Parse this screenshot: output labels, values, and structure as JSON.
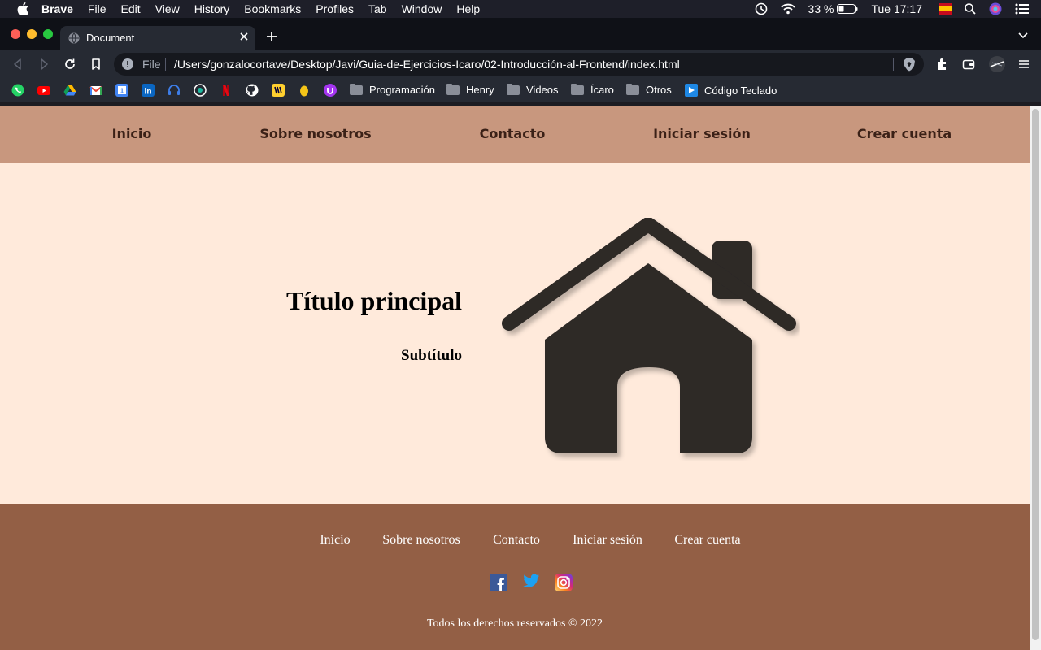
{
  "menubar": {
    "app": "Brave",
    "items": [
      "File",
      "Edit",
      "View",
      "History",
      "Bookmarks",
      "Profiles",
      "Tab",
      "Window",
      "Help"
    ],
    "battery": "33 %",
    "clock": "Tue 17:17"
  },
  "browser": {
    "tab_title": "Document",
    "url_scheme": "File",
    "url": "/Users/gonzalocortave/Desktop/Javi/Guia-de-Ejercicios-Icaro/02-Introducción-al-Frontend/index.html"
  },
  "bookmarks": {
    "icons": [
      "whatsapp-icon",
      "youtube-icon",
      "google-drive-icon",
      "gmail-icon",
      "google-calendar-icon",
      "linkedin-icon",
      "headphones-icon",
      "music-icon",
      "netflix-icon",
      "github-icon",
      "miro-icon",
      "egg-icon",
      "udemy-icon"
    ],
    "folders": [
      "Programación",
      "Henry",
      "Videos",
      "Ícaro",
      "Otros"
    ],
    "link": "Código Teclado"
  },
  "site": {
    "nav": [
      "Inicio",
      "Sobre nosotros",
      "Contacto",
      "Iniciar sesión",
      "Crear cuenta"
    ],
    "title": "Título principal",
    "subtitle": "Subtítulo",
    "footer_links": [
      "Inicio",
      "Sobre nosotros",
      "Contacto",
      "Iniciar sesión",
      "Crear cuenta"
    ],
    "social": [
      "facebook-icon",
      "twitter-icon",
      "instagram-icon"
    ],
    "copyright": "Todos los derechos reservados © 2022"
  },
  "colors": {
    "nav_bg": "#c8977e",
    "page_bg": "#ffeadb",
    "footer_bg": "#935f45",
    "house": "#2d2926"
  }
}
